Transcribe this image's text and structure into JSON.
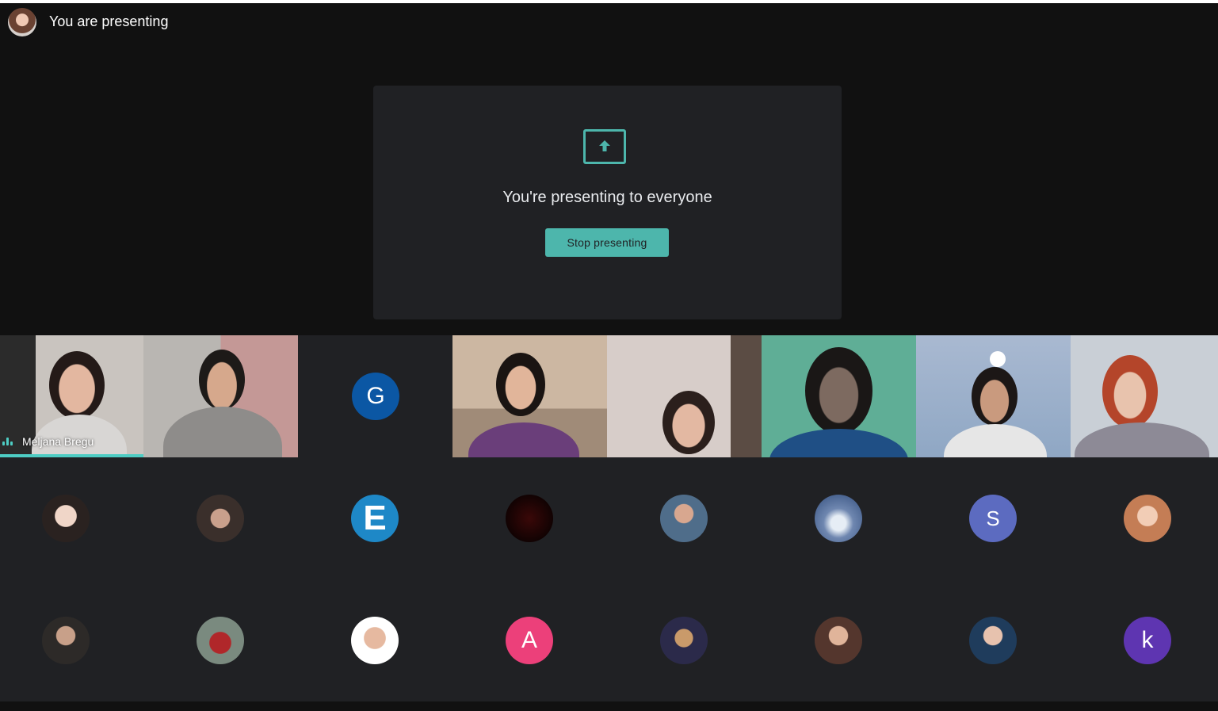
{
  "header": {
    "title": "You are presenting"
  },
  "present": {
    "message": "You're presenting to everyone",
    "stop_label": "Stop presenting",
    "accent": "#4db6ac"
  },
  "speaker": {
    "name": "Meljana Bregu",
    "indicator_color": "#4ecdc4"
  },
  "letter_avatars": [
    {
      "letter": "G",
      "color": "#0b57a4"
    },
    {
      "letter": "S",
      "color": "#5c6bc0"
    },
    {
      "letter": "A",
      "color": "#ec407a"
    },
    {
      "letter": "k",
      "color": "#5e35b1"
    }
  ]
}
